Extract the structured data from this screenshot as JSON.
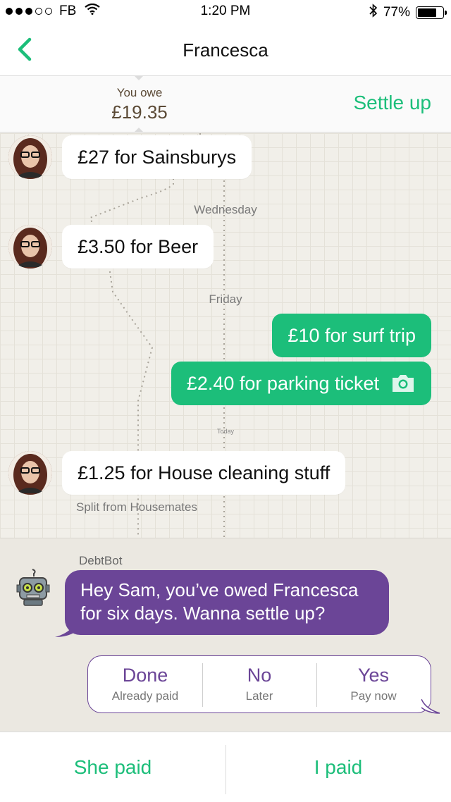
{
  "status_bar": {
    "carrier": "FB",
    "time": "1:20 PM",
    "battery": "77%",
    "battery_level": 0.77,
    "signal_bars_filled": 3,
    "signal_bars_total": 5
  },
  "nav": {
    "title": "Francesca",
    "back_icon": "chevron-left-icon"
  },
  "balance": {
    "label": "You owe",
    "amount": "£19.35",
    "settle_label": "Settle up"
  },
  "timeline": {
    "messages": [
      {
        "text": "£27 for Sainsburys",
        "direction": "in"
      },
      {
        "text": "£3.50 for Beer",
        "direction": "in"
      },
      {
        "text": "£10 for surf trip",
        "direction": "out"
      },
      {
        "text": "£2.40 for parking ticket",
        "direction": "out",
        "icon": "camera-icon"
      },
      {
        "text": "£1.25 for House cleaning stuff",
        "direction": "in",
        "note": "Split from Housemates"
      }
    ],
    "day_labels": [
      "Wednesday",
      "Friday",
      "Today"
    ]
  },
  "bot": {
    "name": "DebtBot",
    "message": "Hey Sam, you’ve owed Francesca for six days. Wanna settle up?",
    "options": [
      {
        "label": "Done",
        "sub": "Already paid"
      },
      {
        "label": "No",
        "sub": "Later"
      },
      {
        "label": "Yes",
        "sub": "Pay now"
      }
    ]
  },
  "actions": {
    "she_paid": "She paid",
    "i_paid": "I paid"
  },
  "colors": {
    "accent_green": "#1cbe7a",
    "bot_purple": "#6b4597",
    "balance_brown": "#5b4a36"
  }
}
